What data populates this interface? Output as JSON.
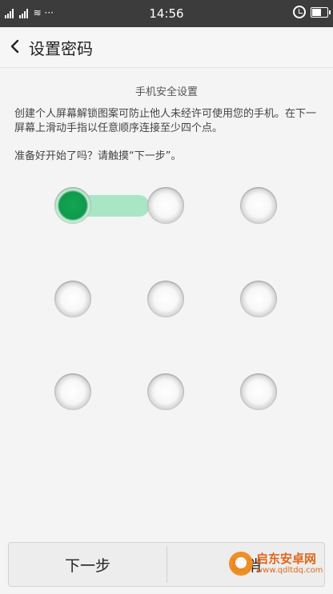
{
  "status_bar": {
    "left_text": "ıl ı.ıl ≋ ···",
    "time": "14:56",
    "alarm_icon": "alarm-clock-icon",
    "battery_level": 0.7
  },
  "header": {
    "back_icon": "chevron-left-icon",
    "title": "设置密码"
  },
  "content": {
    "subtitle": "手机安全设置",
    "description": "创建个人屏幕解锁图案可防止他人未经许可使用您的手机。在下一屏幕上滑动手指以任意顺序连接至少四个点。",
    "prompt": "准备好开始了吗？请触摸“下一步”。"
  },
  "pattern": {
    "dots": 9,
    "active_index": 0,
    "accent_color": "#0f9a4c",
    "track_color": "#a8e6c4"
  },
  "footer": {
    "next_label": "下一步",
    "right_label": "取消"
  },
  "watermark": {
    "title": "启东安卓网",
    "url": "www.qdltdq.com"
  }
}
